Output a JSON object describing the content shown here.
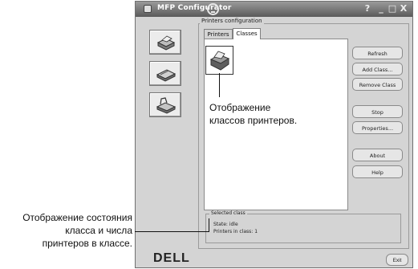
{
  "window": {
    "title": "MFP Configurator"
  },
  "window_buttons": [
    "?",
    "_",
    "□",
    "X"
  ],
  "nav": [
    {
      "icon": "printer-icon"
    },
    {
      "icon": "scanner-icon"
    },
    {
      "icon": "fax-icon"
    }
  ],
  "group": {
    "label": "Printers configuration"
  },
  "tabs": [
    {
      "label": "Printers"
    },
    {
      "label": "Classes"
    }
  ],
  "buttons": [
    "Refresh",
    "Add Class...",
    "Remove Class",
    "Stop",
    "Properties...",
    "About",
    "Help"
  ],
  "status": {
    "label": "Selected class",
    "state": "State: idle",
    "count": "Printers in class: 1"
  },
  "footer": {
    "logo": "DELL",
    "exit": "Exit"
  },
  "annotations": {
    "top": [
      "Отображение",
      "классов принтеров."
    ],
    "left": [
      "Отображение состояния",
      "класса и числа",
      "принтеров в классе."
    ]
  }
}
